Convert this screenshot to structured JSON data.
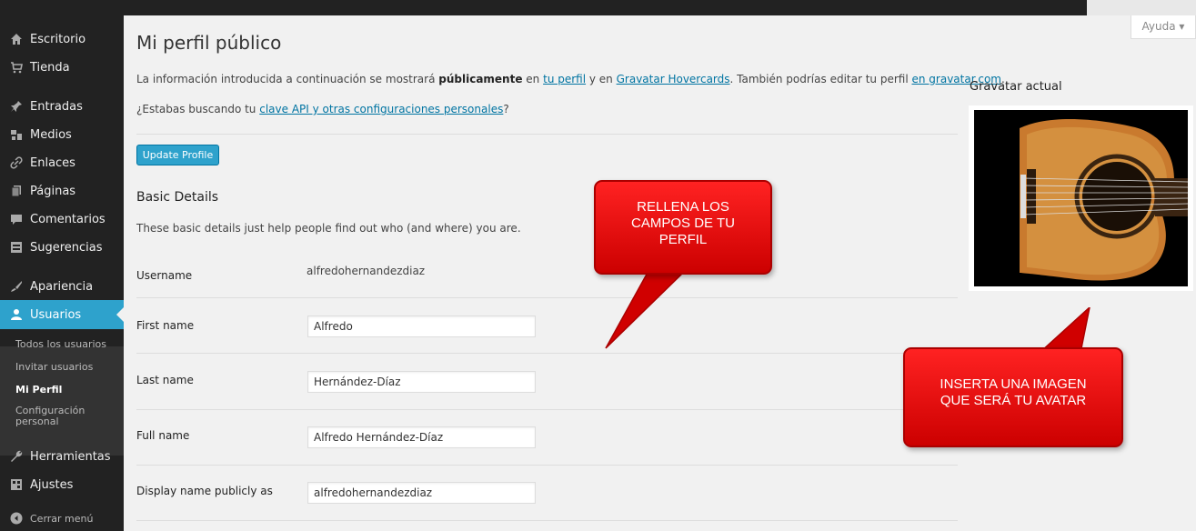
{
  "help": {
    "label": "Ayuda ▾"
  },
  "sidebar": {
    "items": [
      {
        "label": "Escritorio",
        "icon": "home-icon"
      },
      {
        "label": "Tienda",
        "icon": "cart-icon"
      },
      {
        "label": "Entradas",
        "icon": "pin-icon"
      },
      {
        "label": "Medios",
        "icon": "media-icon"
      },
      {
        "label": "Enlaces",
        "icon": "link-icon"
      },
      {
        "label": "Páginas",
        "icon": "pages-icon"
      },
      {
        "label": "Comentarios",
        "icon": "comment-icon"
      },
      {
        "label": "Sugerencias",
        "icon": "suggestions-icon"
      },
      {
        "label": "Apariencia",
        "icon": "brush-icon"
      },
      {
        "label": "Usuarios",
        "icon": "user-icon"
      },
      {
        "label": "Herramientas",
        "icon": "wrench-icon"
      },
      {
        "label": "Ajustes",
        "icon": "settings-icon"
      },
      {
        "label": "Cerrar menú",
        "icon": "collapse-icon"
      }
    ],
    "submenu": [
      {
        "label": "Todos los usuarios"
      },
      {
        "label": "Invitar usuarios"
      },
      {
        "label": "Mi Perfil"
      },
      {
        "label_line1": "Configuración",
        "label_line2": "personal"
      }
    ],
    "accent_color": "#2ea2cc"
  },
  "main": {
    "title": "Mi perfil público",
    "intro": {
      "t1": "La información introducida a continuación se mostrará ",
      "bold": "públicamente",
      "t2": " en ",
      "link1": "tu perfil",
      "t3": " y en ",
      "link2": "Gravatar Hovercards",
      "t4": ". También podrías editar tu perfil ",
      "link3": "en gravatar.com",
      "t5": "."
    },
    "api": {
      "t1": "¿Estabas buscando tu ",
      "link": "clave API y otras configuraciones personales",
      "t2": "?"
    },
    "update_button": "Update Profile",
    "basic_title": "Basic Details",
    "basic_desc": "These basic details just help people find out who (and where) you are.",
    "fields": {
      "username": {
        "label": "Username",
        "value": "alfredohernandezdiaz"
      },
      "first_name": {
        "label": "First name",
        "value": "Alfredo"
      },
      "last_name": {
        "label": "Last name",
        "value": "Hernández-Díaz"
      },
      "full_name": {
        "label": "Full name",
        "value": "Alfredo Hernández-Díaz"
      },
      "display_name": {
        "label": "Display name publicly as",
        "value": "alfredohernandezdiaz"
      }
    }
  },
  "gravatar": {
    "title": "Gravatar actual"
  },
  "callouts": {
    "fill": {
      "line1": "RELLENA LOS",
      "line2": "CAMPOS DE TU",
      "line3": "PERFIL"
    },
    "avatar": {
      "line1": "INSERTA UNA IMAGEN",
      "line2": "QUE SERÁ TU AVATAR"
    },
    "color": "#e00000"
  }
}
